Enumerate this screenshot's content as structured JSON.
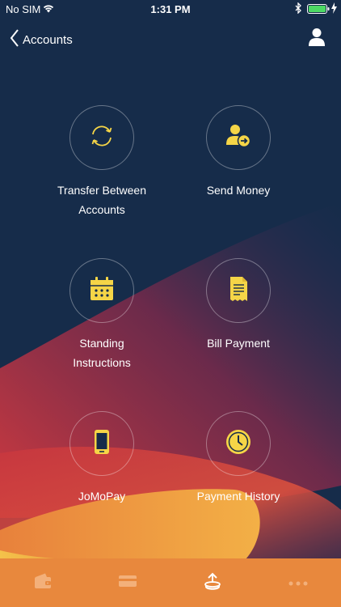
{
  "status_bar": {
    "carrier": "No SIM",
    "time": "1:31 PM"
  },
  "nav": {
    "back_label": "Accounts"
  },
  "menu": {
    "items": [
      {
        "label_lines": [
          "Transfer Between",
          "Accounts"
        ],
        "icon": "transfer-arrows-icon"
      },
      {
        "label_lines": [
          "Send Money"
        ],
        "icon": "user-send-icon"
      },
      {
        "label_lines": [
          "Standing",
          "Instructions"
        ],
        "icon": "calendar-icon"
      },
      {
        "label_lines": [
          "Bill Payment"
        ],
        "icon": "receipt-icon"
      },
      {
        "label_lines": [
          "JoMoPay"
        ],
        "icon": "mobile-phone-icon"
      },
      {
        "label_lines": [
          "Payment History"
        ],
        "icon": "clock-icon"
      }
    ]
  },
  "tab_bar": {
    "tabs": [
      {
        "icon": "wallet-icon",
        "active": false
      },
      {
        "icon": "card-icon",
        "active": false
      },
      {
        "icon": "transfer-upload-icon",
        "active": true
      },
      {
        "icon": "more-dots-icon",
        "active": false
      }
    ]
  },
  "colors": {
    "background": "#162c4a",
    "accent_yellow": "#f5d547",
    "tab_bar": "#e8883d",
    "wave_red": "#c8373f",
    "wave_orange": "#f0a23e"
  }
}
